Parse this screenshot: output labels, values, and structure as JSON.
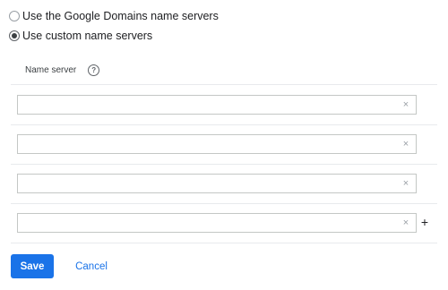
{
  "server_options": [
    {
      "label": "Use the Google Domains name servers",
      "selected": false
    },
    {
      "label": "Use custom name servers",
      "selected": true
    }
  ],
  "name_server_section": {
    "header_label": "Name server",
    "help_icon": "help-circle-icon",
    "help_glyph": "?",
    "clear_glyph": "×",
    "add_glyph": "+",
    "inputs": [
      {
        "value": "",
        "placeholder": ""
      },
      {
        "value": "",
        "placeholder": ""
      },
      {
        "value": "",
        "placeholder": ""
      },
      {
        "value": "",
        "placeholder": ""
      }
    ]
  },
  "actions": {
    "save_label": "Save",
    "cancel_label": "Cancel"
  },
  "colors": {
    "accent": "#1a73e8",
    "border": "#c4c7c5",
    "divider": "#e8eaed",
    "text": "#202124"
  }
}
